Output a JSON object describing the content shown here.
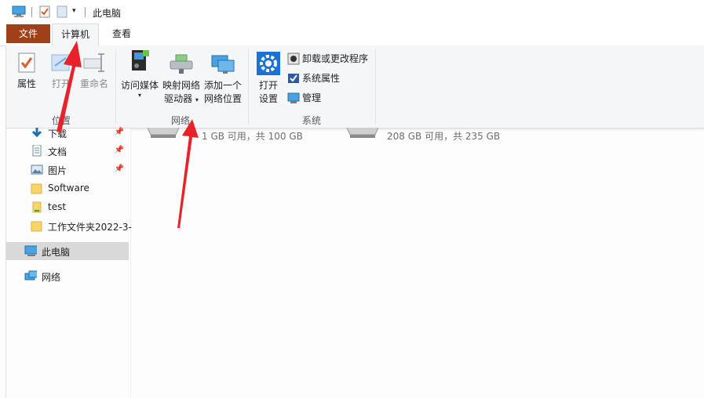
{
  "window": {
    "title": "此电脑"
  },
  "tabs": {
    "file": "文件",
    "computer": "计算机",
    "view": "查看"
  },
  "ribbon": {
    "location": {
      "label": "位置",
      "properties": "属性",
      "open": "打开",
      "rename": "重命名"
    },
    "network": {
      "label": "网络",
      "access_media": "访问媒体",
      "map_drive_1": "映射网络",
      "map_drive_2": "驱动器",
      "add_location_1": "添加一个",
      "add_location_2": "网络位置"
    },
    "system": {
      "label": "系统",
      "open_settings_1": "打开",
      "open_settings_2": "设置",
      "uninstall": "卸载或更改程序",
      "system_properties": "系统属性",
      "manage": "管理"
    }
  },
  "nav": {
    "items": [
      {
        "label": "下载",
        "icon": "download-icon",
        "pinned": true
      },
      {
        "label": "文档",
        "icon": "document-icon",
        "pinned": true
      },
      {
        "label": "图片",
        "icon": "pictures-icon",
        "pinned": true
      },
      {
        "label": "Software",
        "icon": "folder-icon",
        "pinned": false
      },
      {
        "label": "test",
        "icon": "folder-icon",
        "pinned": false
      },
      {
        "label": "工作文件夹2022-3-",
        "icon": "folder-icon",
        "pinned": false
      }
    ],
    "this_pc": "此电脑",
    "network": "网络"
  },
  "drives": [
    {
      "free_text": "1 GB 可用，共 100 GB"
    },
    {
      "free_text": "208 GB 可用，共 235 GB"
    }
  ],
  "colors": {
    "file_tab": "#a0401a",
    "annotation_arrow": "#e8222a",
    "selected_nav": "#d9d9d9"
  }
}
